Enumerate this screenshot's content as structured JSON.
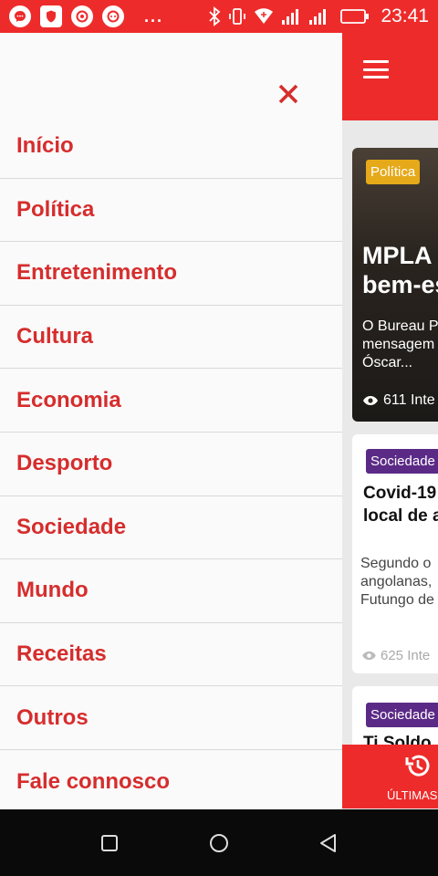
{
  "status_bar": {
    "time": "23:41",
    "dots": "...",
    "colors": {
      "background": "#ee2b2b"
    },
    "icons": [
      "messenger-icon",
      "shield-icon",
      "record-icon",
      "chat-icon",
      "bluetooth-icon",
      "vibrate-icon",
      "wifi-icon",
      "signal-icon",
      "signal-icon",
      "battery-icon"
    ]
  },
  "drawer": {
    "close_icon": "close-icon",
    "items": [
      {
        "label": "Início"
      },
      {
        "label": "Política"
      },
      {
        "label": "Entretenimento"
      },
      {
        "label": "Cultura"
      },
      {
        "label": "Economia"
      },
      {
        "label": "Desporto"
      },
      {
        "label": "Sociedade"
      },
      {
        "label": "Mundo"
      },
      {
        "label": "Receitas"
      },
      {
        "label": "Outros"
      },
      {
        "label": "Fale connosco"
      }
    ],
    "colors": {
      "text": "#d62d2d",
      "divider": "#d9d9d9"
    }
  },
  "background_app": {
    "menu_icon": "hamburger-icon",
    "cards": [
      {
        "category": "Política",
        "title": "MPLA e\nbem-es",
        "description": "O Bureau P\nmensagem\nÓscar...",
        "views": "611 Inte"
      },
      {
        "category": "Sociedade",
        "title": "Covid-19\nlocal de a",
        "description": "Segundo o\nangolanas,\nFutungo de",
        "views": "625 Inte"
      },
      {
        "category": "Sociedade",
        "title": "Ti Soldo"
      }
    ],
    "bottom_tab": {
      "label": "ÚLTIMAS",
      "icon": "history-icon"
    },
    "colors": {
      "accent": "#ee2b2b",
      "politica_badge": "#e5a91a",
      "sociedade_badge": "#5b2a86"
    }
  },
  "nav_bar": {
    "buttons": [
      "recents-icon",
      "home-icon",
      "back-icon"
    ]
  }
}
